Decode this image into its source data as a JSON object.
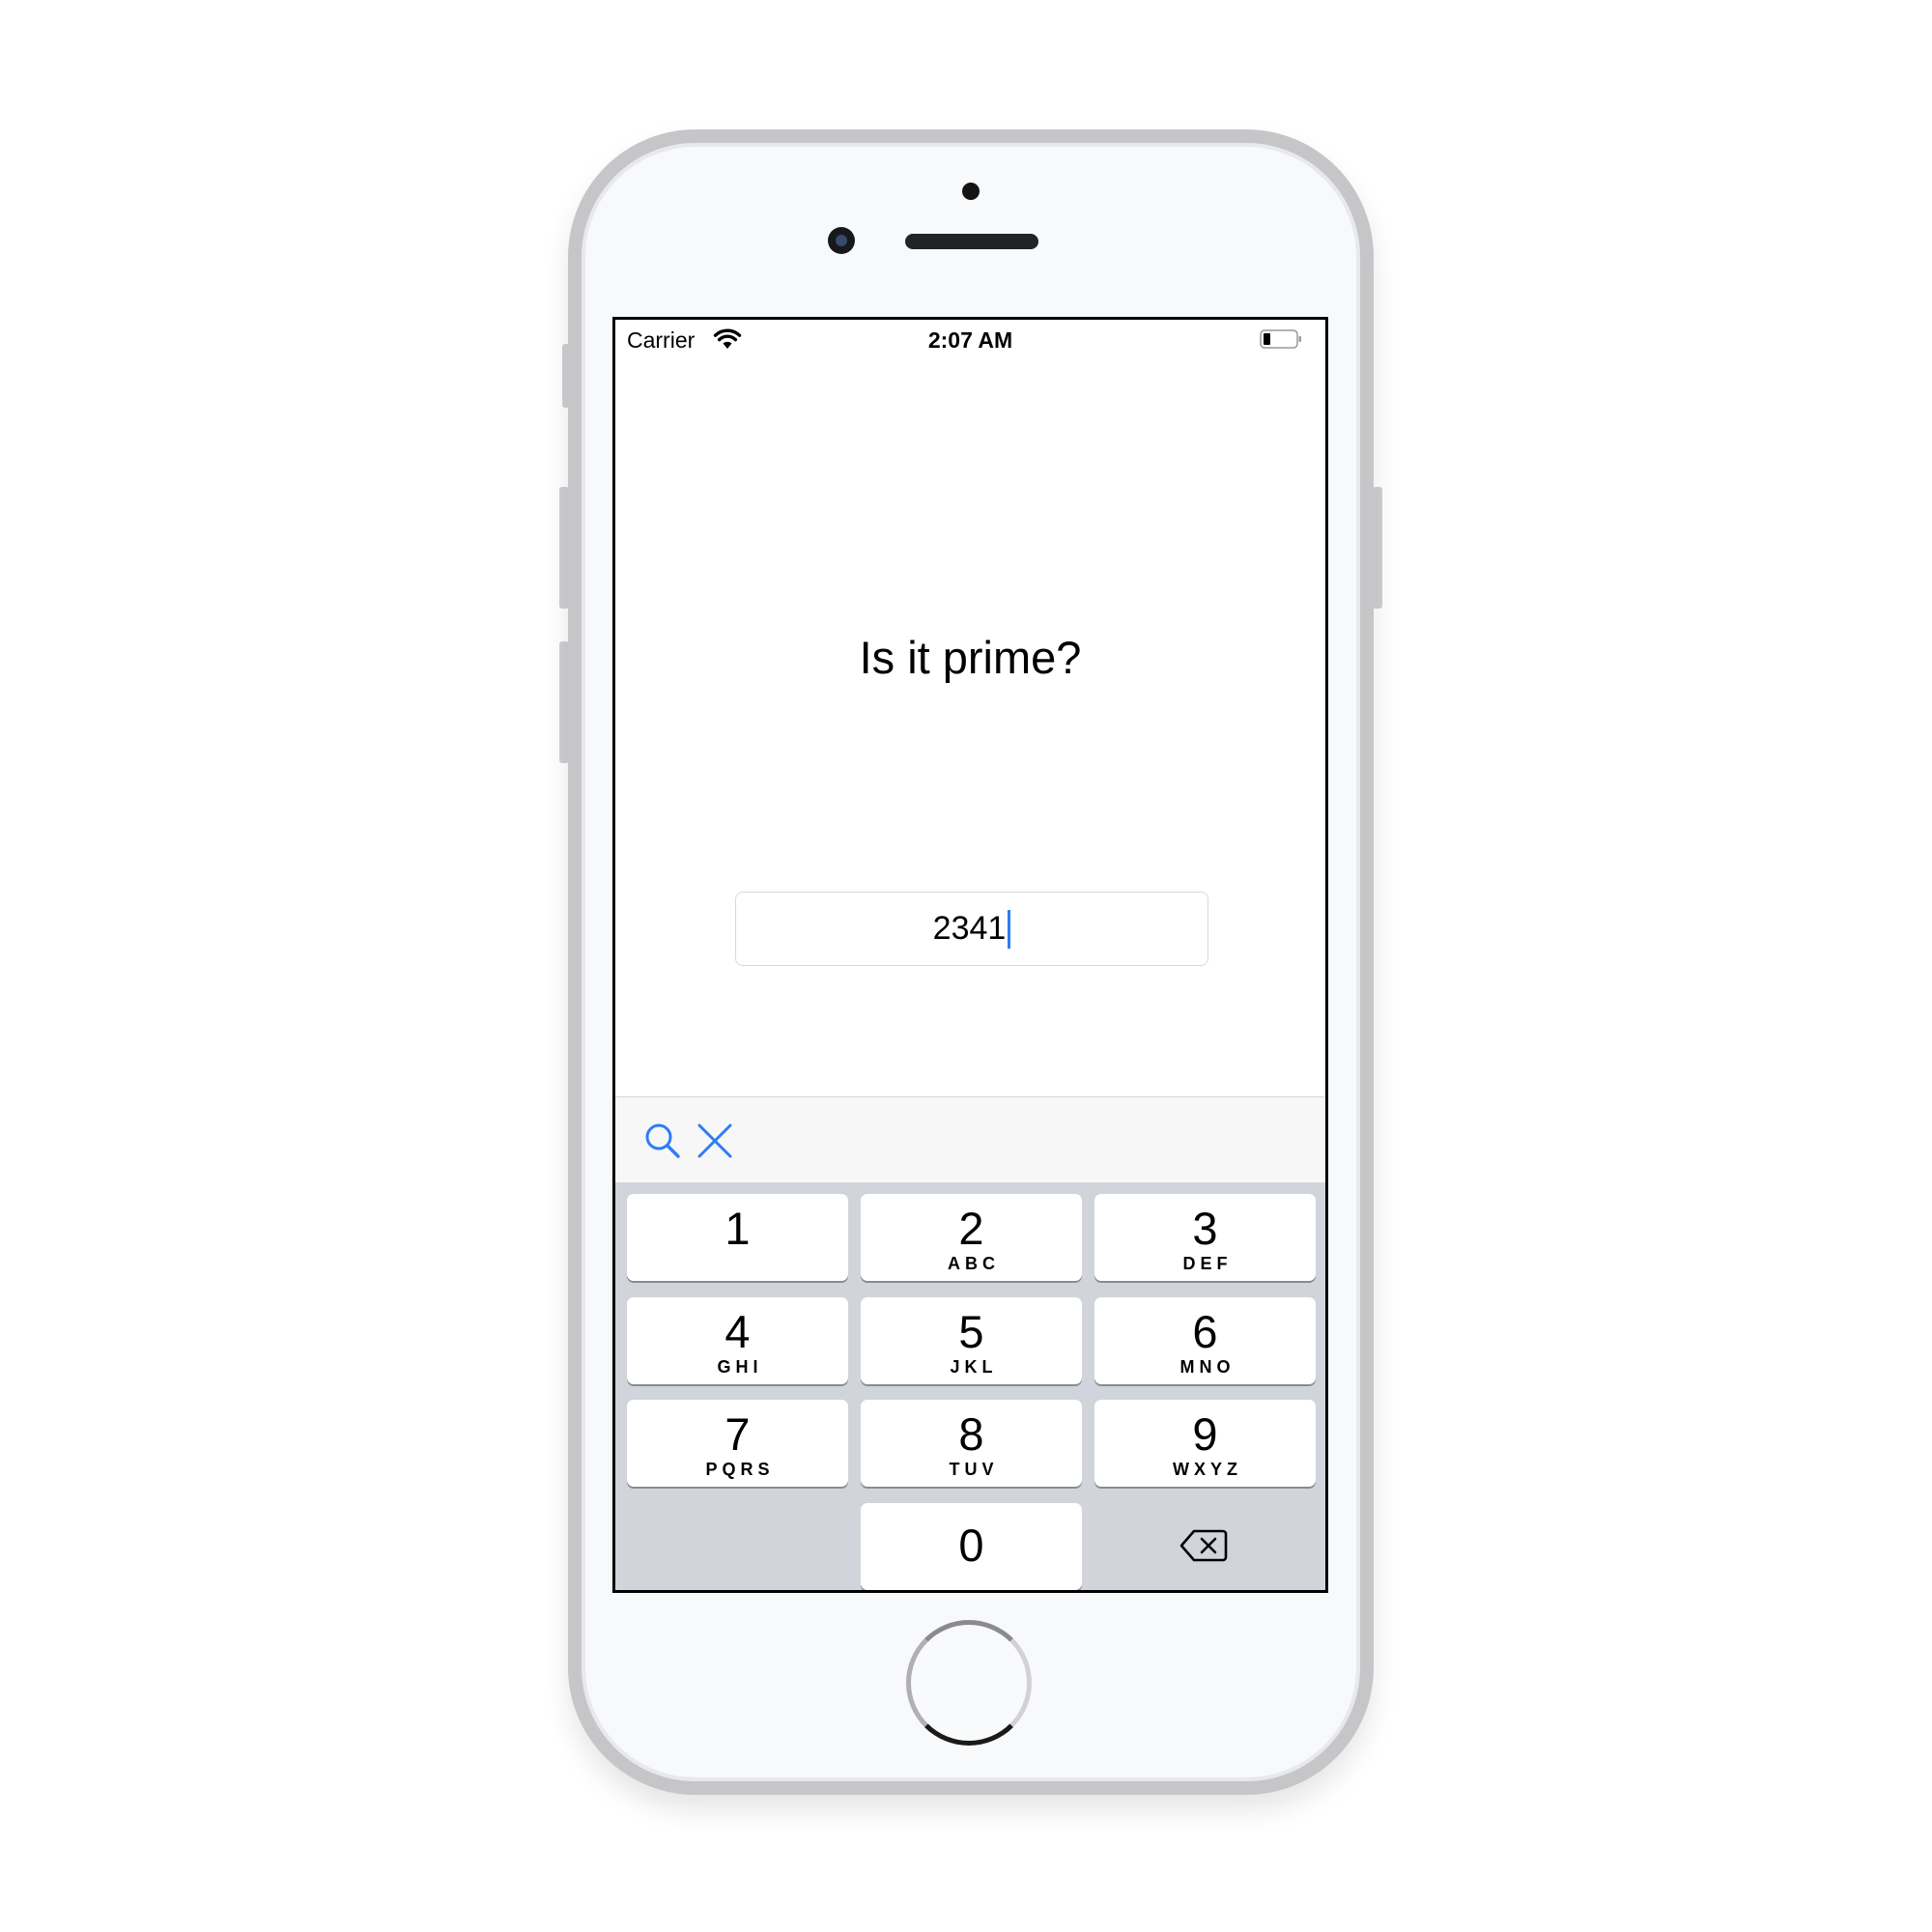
{
  "status_bar": {
    "carrier": "Carrier",
    "time": "2:07 AM",
    "icons": [
      "wifi-icon",
      "battery-icon"
    ]
  },
  "app": {
    "title": "Is it prime?",
    "number_field": {
      "value": "2341",
      "placeholder": ""
    }
  },
  "keyboard": {
    "toolbar_icons": [
      "search-icon",
      "close-icon"
    ],
    "accent_color": "#2f7cf6",
    "keys": [
      {
        "digit": "1",
        "letters": ""
      },
      {
        "digit": "2",
        "letters": "ABC"
      },
      {
        "digit": "3",
        "letters": "DEF"
      },
      {
        "digit": "4",
        "letters": "GHI"
      },
      {
        "digit": "5",
        "letters": "JKL"
      },
      {
        "digit": "6",
        "letters": "MNO"
      },
      {
        "digit": "7",
        "letters": "PQRS"
      },
      {
        "digit": "8",
        "letters": "TUV"
      },
      {
        "digit": "9",
        "letters": "WXYZ"
      },
      {
        "digit": "0",
        "letters": ""
      }
    ],
    "delete_icon": "backspace-icon"
  }
}
